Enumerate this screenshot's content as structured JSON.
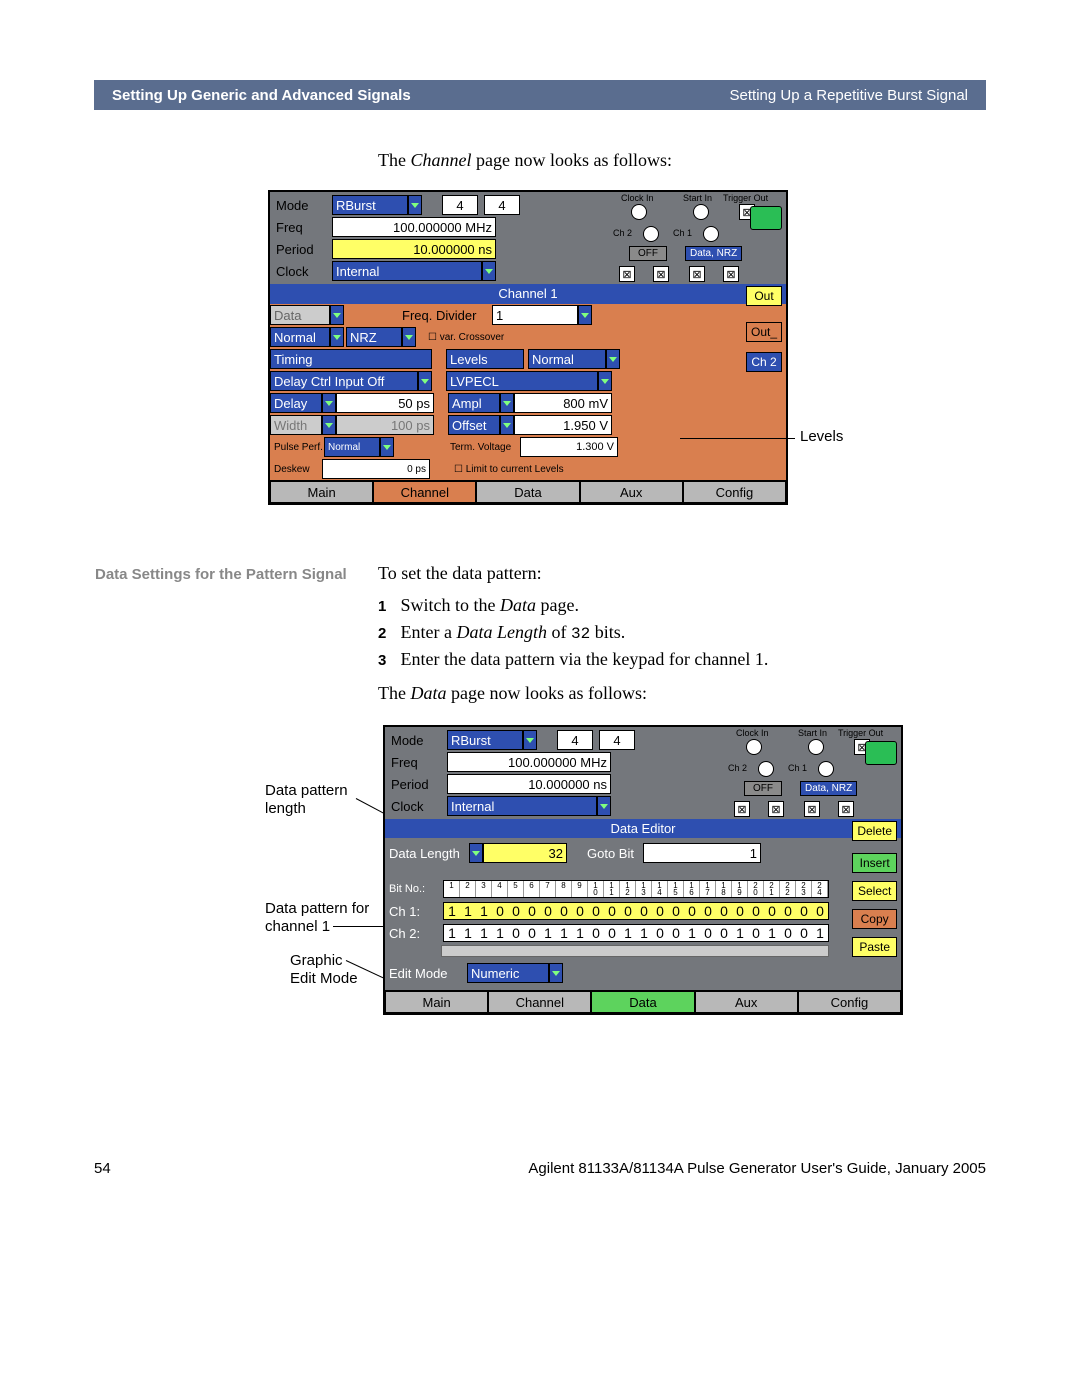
{
  "header": {
    "left": "Setting Up Generic and Advanced Signals",
    "right": "Setting Up a Repetitive Burst Signal"
  },
  "intro": {
    "line1a": "The ",
    "line1b": "Channel",
    "line1c": " page now looks as follows:"
  },
  "fig1": {
    "mode": {
      "label": "Mode",
      "value": "RBurst",
      "n1": "4",
      "n2": "4"
    },
    "freq": {
      "label": "Freq",
      "value": "100.000000 MHz"
    },
    "period": {
      "label": "Period",
      "value": "10.000000 ns"
    },
    "clock": {
      "label": "Clock",
      "value": "Internal"
    },
    "tr": {
      "clockin": "Clock In",
      "startin": "Start In",
      "trigout": "Trigger Out",
      "ch2": "Ch 2",
      "ch1": "Ch 1",
      "off": "OFF",
      "datanrz": "Data, NRZ"
    },
    "ch": {
      "title": "Channel 1",
      "data": "Data",
      "freqdiv": "Freq. Divider",
      "freqdivval": "1",
      "normal": "Normal",
      "nrz": "NRZ",
      "varcross": "var. Crossover",
      "timing": "Timing",
      "levels": "Levels",
      "lvlnorm": "Normal",
      "dci": "Delay Ctrl Input Off",
      "lvpecl": "LVPECL",
      "delay": "Delay",
      "delayval": "50 ps",
      "ampl": "Ampl",
      "amplval": "800 mV",
      "width": "Width",
      "widthval": "100 ps",
      "offset": "Offset",
      "offsetval": "1.950 V",
      "pperf": "Pulse Perf.",
      "ppnorm": "Normal",
      "tvolt": "Term. Voltage",
      "tvoltval": "1.300 V",
      "deskew": "Deskew",
      "deskewval": "0 ps",
      "limit": "Limit to current Levels"
    },
    "side": {
      "out": "Out",
      "out_": "Out_",
      "ch2": "Ch 2"
    },
    "nav": {
      "main": "Main",
      "channel": "Channel",
      "data": "Data",
      "aux": "Aux",
      "config": "Config"
    }
  },
  "annot1": "Levels",
  "section2": "Data Settings for the Pattern Signal",
  "body2": {
    "intro": "To set the data pattern:",
    "s1a": "Switch to the ",
    "s1b": "Data",
    "s1c": " page.",
    "s2a": "Enter a ",
    "s2b": "Data Length",
    "s2c": " of ",
    "s2d": "32",
    "s2e": " bits.",
    "s3": "Enter the data pattern via the keypad for channel 1.",
    "end1": "The ",
    "end2": "Data",
    "end3": " page now looks as follows:"
  },
  "annot2": {
    "a": "Data pattern",
    "b": "length",
    "c": "Data pattern for",
    "d": "channel 1",
    "e": "Graphic",
    "f": "Edit Mode"
  },
  "fig2": {
    "de": {
      "title": "Data Editor",
      "dlen": "Data Length",
      "dlenval": "32",
      "goto": "Goto Bit",
      "gotoval": "1",
      "bitno": "Bit No.:",
      "ch1": "Ch 1:",
      "ch2": "Ch 2:",
      "editmode": "Edit Mode",
      "numeric": "Numeric"
    },
    "bits": {
      "ch1": "111000000000000000000000",
      "ch2": "111100111001100100101001"
    },
    "side": {
      "del": "Delete",
      "ins": "Insert",
      "sel": "Select",
      "copy": "Copy",
      "paste": "Paste"
    },
    "nav": {
      "main": "Main",
      "channel": "Channel",
      "data": "Data",
      "aux": "Aux",
      "config": "Config"
    }
  },
  "footer": {
    "page": "54",
    "text": "Agilent 81133A/81134A Pulse Generator User's Guide, January 2005"
  }
}
